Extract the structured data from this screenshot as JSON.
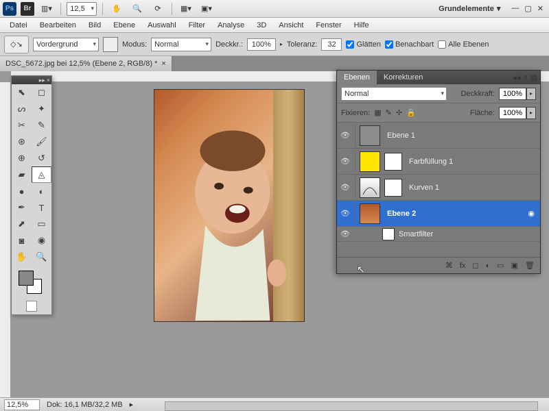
{
  "topbar": {
    "zoom_dd": "12,5",
    "workspace": "Grundelemente"
  },
  "menu": [
    "Datei",
    "Bearbeiten",
    "Bild",
    "Ebene",
    "Auswahl",
    "Filter",
    "Analyse",
    "3D",
    "Ansicht",
    "Fenster",
    "Hilfe"
  ],
  "options": {
    "fg_label": "Vordergrund",
    "mode_label": "Modus:",
    "mode_value": "Normal",
    "opacity_label": "Deckkr.:",
    "opacity_value": "100%",
    "tolerance_label": "Toleranz:",
    "tolerance_value": "32",
    "antialias": "Glätten",
    "contiguous": "Benachbart",
    "all_layers": "Alle Ebenen"
  },
  "doc_tab": "DSC_5672.jpg bei 12,5% (Ebene 2, RGB/8) *",
  "layers_panel": {
    "tabs": [
      "Ebenen",
      "Korrekturen"
    ],
    "blend_mode": "Normal",
    "opacity_label": "Deckkraft:",
    "opacity_value": "100%",
    "lock_label": "Fixieren:",
    "fill_label": "Fläche:",
    "fill_value": "100%",
    "layers": [
      {
        "name": "Ebene 1",
        "thumb": "#8d8d8d"
      },
      {
        "name": "Farbfüllung 1",
        "thumb": "#ffe600",
        "mask": true
      },
      {
        "name": "Kurven 1",
        "thumb": "adj",
        "mask": true
      },
      {
        "name": "Ebene 2",
        "thumb": "photo",
        "selected": true
      },
      {
        "name": "Smartfilter",
        "sf": true
      }
    ]
  },
  "status": {
    "zoom": "12,5%",
    "doc_info": "Dok: 16,1 MB/32,2 MB"
  }
}
